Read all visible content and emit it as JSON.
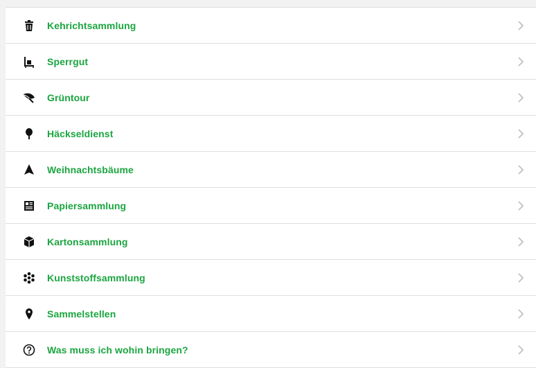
{
  "menu": {
    "items": [
      {
        "label": "Kehrichtsammlung",
        "icon": "trash-bin-icon"
      },
      {
        "label": "Sperrgut",
        "icon": "bulky-goods-icon"
      },
      {
        "label": "Grüntour",
        "icon": "leaf-icon"
      },
      {
        "label": "Häckseldienst",
        "icon": "tree-icon"
      },
      {
        "label": "Weihnachtsbäume",
        "icon": "fir-tree-icon"
      },
      {
        "label": "Papiersammlung",
        "icon": "newspaper-icon"
      },
      {
        "label": "Kartonsammlung",
        "icon": "box-icon"
      },
      {
        "label": "Kunststoffsammlung",
        "icon": "plastic-icon"
      },
      {
        "label": "Sammelstellen",
        "icon": "location-pin-icon"
      },
      {
        "label": "Was muss ich wohin bringen?",
        "icon": "question-icon"
      }
    ]
  },
  "colors": {
    "label_green": "#1aa53f",
    "icon_dark": "#111111",
    "chevron_grey": "#b5b5b5"
  }
}
